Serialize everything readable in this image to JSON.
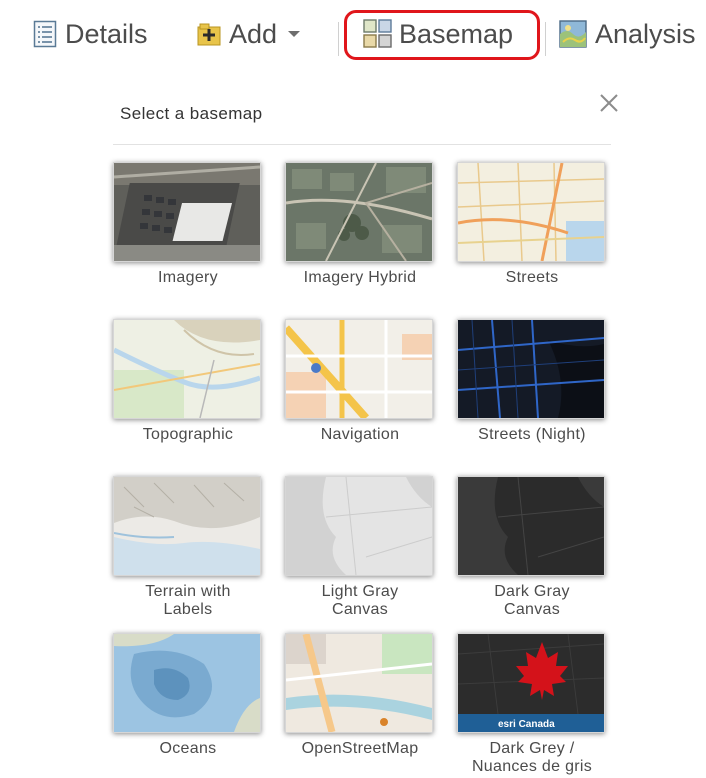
{
  "toolbar": {
    "details_label": "Details",
    "add_label": "Add",
    "basemap_label": "Basemap",
    "analysis_label": "Analysis"
  },
  "panel": {
    "title": "Select a basemap",
    "close_icon": "close-icon"
  },
  "basemaps": [
    {
      "label": "Imagery"
    },
    {
      "label": "Imagery Hybrid"
    },
    {
      "label": "Streets"
    },
    {
      "label": "Topographic"
    },
    {
      "label": "Navigation"
    },
    {
      "label": "Streets (Night)"
    },
    {
      "label": "Terrain with\nLabels"
    },
    {
      "label": "Light Gray\nCanvas"
    },
    {
      "label": "Dark Gray\nCanvas"
    },
    {
      "label": "Oceans"
    },
    {
      "label": "OpenStreetMap"
    },
    {
      "label": "Dark Grey /\nNuances de gris",
      "thumb_text": "esri Canada"
    }
  ],
  "colors": {
    "highlight": "#e0161b",
    "text": "#4c4c4c"
  }
}
